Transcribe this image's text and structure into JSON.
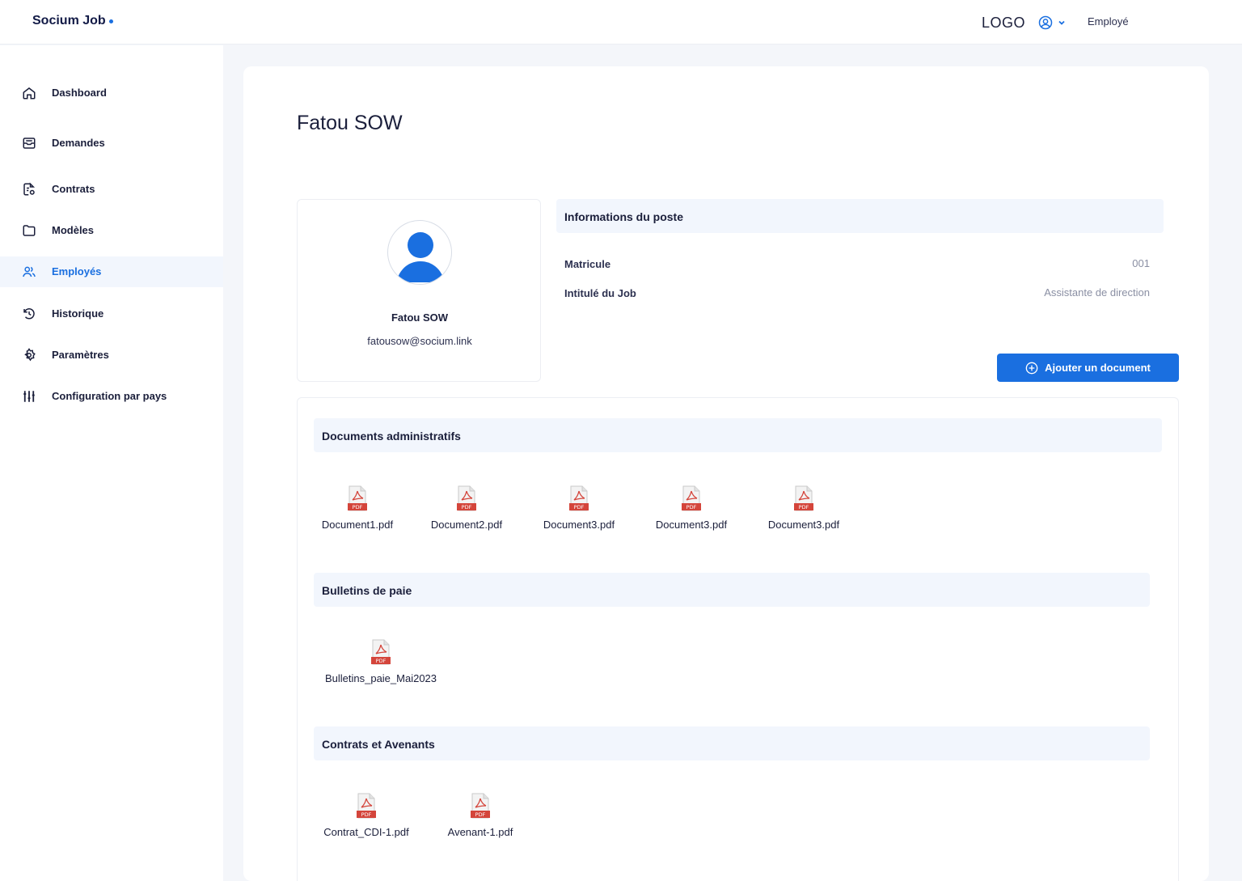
{
  "header": {
    "brand": "Socium Job",
    "logo": "LOGO",
    "role": "Employé",
    "user_icon": "user-circle-icon",
    "accent": "#1a6fe0"
  },
  "sidebar": {
    "items": [
      {
        "label": "Dashboard",
        "icon": "home-icon"
      },
      {
        "label": "Demandes",
        "icon": "inbox-icon"
      },
      {
        "label": "Contrats",
        "icon": "contract-icon"
      },
      {
        "label": "Modèles",
        "icon": "folder-icon"
      },
      {
        "label": "Employés",
        "icon": "users-icon",
        "active": true
      },
      {
        "label": "Historique",
        "icon": "history-icon"
      },
      {
        "label": "Paramètres",
        "icon": "gear-icon"
      },
      {
        "label": "Configuration par pays",
        "icon": "sliders-icon"
      }
    ]
  },
  "main": {
    "title": "Fatou SOW",
    "profile": {
      "name": "Fatou SOW",
      "email": "fatousow@socium.link"
    },
    "job_info": {
      "title": "Informations du poste",
      "matricule_label": "Matricule",
      "matricule_value": "001",
      "job_label": "Intitulé du Job",
      "job_value": "Assistante de direction"
    },
    "add_button": "Ajouter un document",
    "sections": [
      {
        "title": "Documents administratifs",
        "files": [
          "Document1.pdf",
          "Document2.pdf",
          "Document3.pdf",
          "Document3.pdf",
          "Document3.pdf"
        ]
      },
      {
        "title": "Bulletins de paie",
        "files": [
          "Bulletins_paie_Mai2023"
        ]
      },
      {
        "title": "Contrats et Avenants",
        "files": [
          "Contrat_CDI-1.pdf",
          "Avenant-1.pdf"
        ]
      }
    ],
    "pdf_badge": "PDF"
  }
}
